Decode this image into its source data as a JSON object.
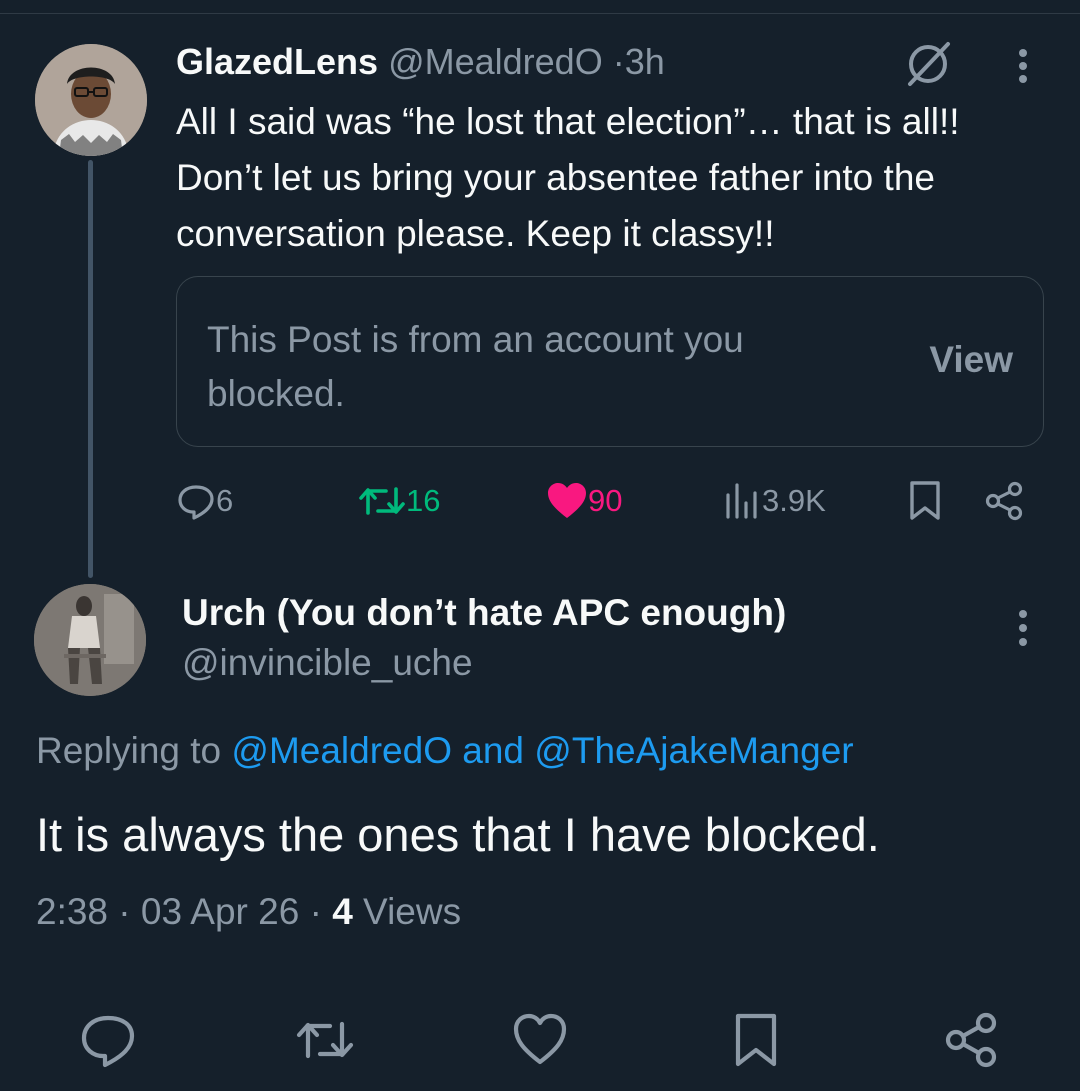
{
  "parent": {
    "name": "GlazedLens",
    "handle": "@MealdredO",
    "dot": "·",
    "time": "3h",
    "text": "All I said was “he lost that election”… that is all!! Don’t let us bring your absentee father into the conversation please. Keep it classy!!",
    "blocked_card": {
      "text": "This Post is from an account you blocked.",
      "view_label": "View"
    },
    "stats": {
      "replies": "6",
      "reposts": "16",
      "likes": "90",
      "views": "3.9K"
    }
  },
  "reply": {
    "name": "Urch (You don’t hate APC enough)",
    "handle": "@invincible_uche",
    "replying_prefix": "Replying to ",
    "replying_user1": "@MealdredO",
    "replying_and": " and ",
    "replying_user2": "@TheAjakeManger",
    "text": "It is always the ones that I have blocked.",
    "time": "2:38",
    "date": "03 Apr 26",
    "dot": " · ",
    "views_count": "4",
    "views_label": " Views"
  },
  "icons": {
    "parent_avatar": "avatar-photo",
    "reply_avatar": "avatar-photo",
    "grok": "grok-slash-circle-icon",
    "more": "more-vertical-icon",
    "reply": "speech-bubble-icon",
    "repost": "repost-arrows-icon",
    "like": "heart-icon",
    "views": "bar-chart-icon",
    "bookmark": "bookmark-icon",
    "share": "share-nodes-icon"
  },
  "colors": {
    "background": "#15202b",
    "text": "#f7f9f9",
    "muted": "#8b98a5",
    "link": "#1d9bf0",
    "repost_active": "#00ba7c",
    "like_active": "#f91880"
  }
}
